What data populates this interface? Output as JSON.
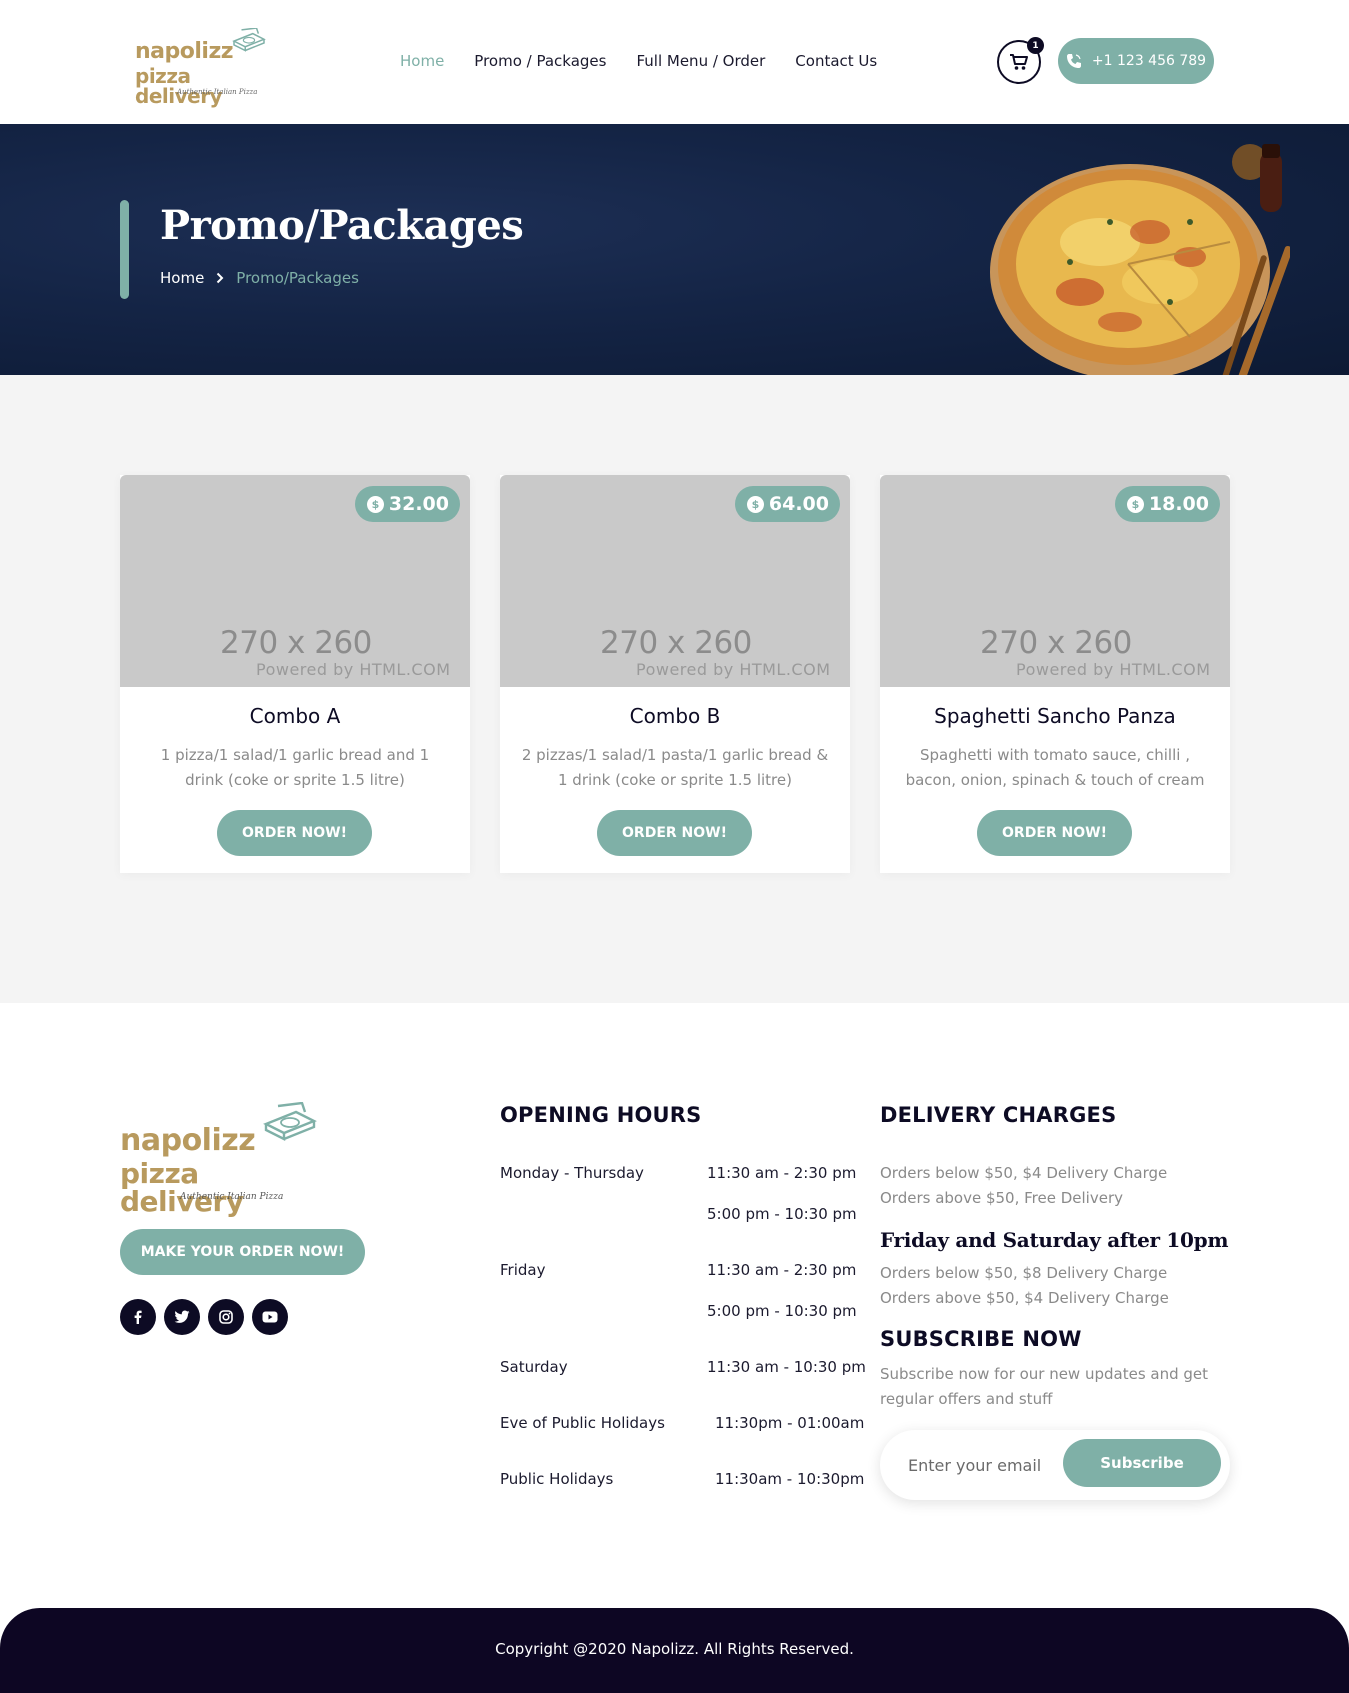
{
  "brand": {
    "logo_line1": "napolizz",
    "logo_line2": "pizza delivery",
    "logo_tagline": "Authentic Italian Pizza"
  },
  "nav": {
    "items": [
      {
        "label": "Home",
        "active": true
      },
      {
        "label": "Promo / Packages",
        "active": false
      },
      {
        "label": "Full Menu / Order",
        "active": false
      },
      {
        "label": "Contact Us",
        "active": false
      }
    ],
    "cart_count": "1",
    "phone": "+1 123 456 789"
  },
  "hero": {
    "title": "Promo/Packages",
    "breadcrumb": {
      "home": "Home",
      "current": "Promo/Packages"
    }
  },
  "products": [
    {
      "price": "32.00",
      "placeholder_size": "270 x 260",
      "placeholder_credit": "Powered by HTML.COM",
      "title": "Combo A",
      "description": "1 pizza/1 salad/1 garlic bread and 1 drink (coke or sprite 1.5 litre)",
      "button": "ORDER NOW!"
    },
    {
      "price": "64.00",
      "placeholder_size": "270 x 260",
      "placeholder_credit": "Powered by HTML.COM",
      "title": "Combo B",
      "description": "2 pizzas/1 salad/1 pasta/1 garlic bread & 1 drink (coke or sprite 1.5 litre)",
      "button": "ORDER NOW!"
    },
    {
      "price": "18.00",
      "placeholder_size": "270 x 260",
      "placeholder_credit": "Powered by HTML.COM",
      "title": "Spaghetti Sancho Panza",
      "description": "Spaghetti with tomato sauce, chilli , bacon, onion, spinach & touch of cream",
      "button": "ORDER NOW!"
    }
  ],
  "footer": {
    "make_order_button": "MAKE YOUR ORDER NOW!",
    "socials": [
      "facebook-icon",
      "twitter-icon",
      "instagram-icon",
      "youtube-icon"
    ],
    "opening_hours": {
      "title": "OPENING HOURS",
      "rows": [
        {
          "day": "Monday - Thursday",
          "times": [
            "11:30 am - 2:30 pm",
            "5:00 pm - 10:30 pm"
          ]
        },
        {
          "day": "Friday",
          "times": [
            "11:30 am - 2:30 pm",
            "5:00 pm - 10:30 pm"
          ]
        },
        {
          "day": "Saturday",
          "times": [
            "11:30 am - 10:30 pm"
          ]
        },
        {
          "day": "Eve of Public Holidays",
          "times": [
            "11:30pm - 01:00am"
          ]
        },
        {
          "day": "Public Holidays",
          "times": [
            "11:30am - 10:30pm"
          ]
        }
      ]
    },
    "delivery": {
      "title": "DELIVERY CHARGES",
      "lines": [
        "Orders below $50, $4 Delivery Charge",
        "Orders above $50, Free Delivery"
      ],
      "subtitle": "Friday and Saturday after 10pm",
      "sub_lines": [
        "Orders below $50, $8 Delivery Charge",
        "Orders above $50, $4 Delivery Charge"
      ]
    },
    "subscribe": {
      "title": "SUBSCRIBE NOW",
      "description": "Subscribe now for our new updates and get regular offers and stuff",
      "placeholder": "Enter your email",
      "button": "Subscribe"
    },
    "copyright": "Copyright @2020 Napolizz. All Rights Reserved."
  },
  "colors": {
    "accent": "#7fb0a7",
    "dark": "#0d0b24",
    "gold": "#b89a5e",
    "muted_text": "#8a8a8a",
    "section_bg": "#f4f4f4"
  }
}
